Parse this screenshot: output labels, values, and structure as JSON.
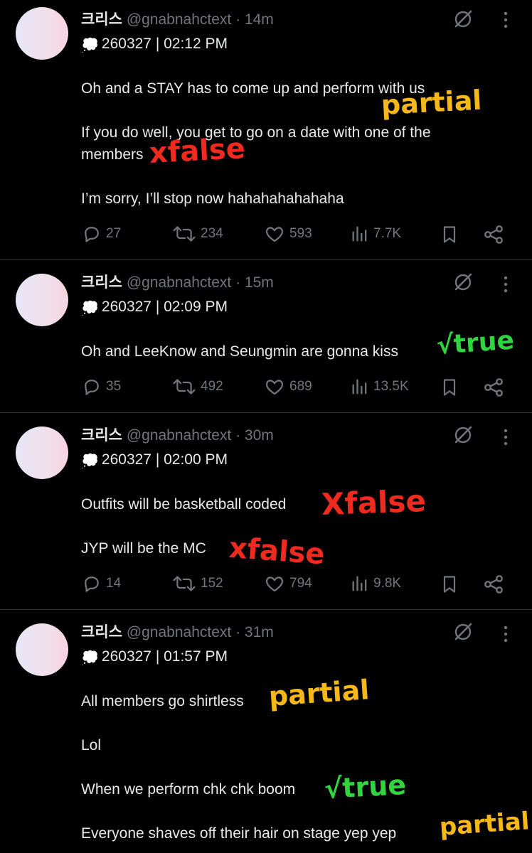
{
  "tweets": [
    {
      "name": "크리스",
      "handle": "@gnabnahctext",
      "time": "14m",
      "dot": "·",
      "sub": "260327 | 02:12 PM",
      "lines": [
        "Oh and a STAY has to come up and perform with us",
        "If you do well, you get to go on a date with one of the",
        "members",
        "I’m sorry, I’ll stop now hahahahahahaha"
      ],
      "replies": "27",
      "retweets": "234",
      "likes": "593",
      "views": "7.7K",
      "annotations": [
        "partial",
        "xfalse"
      ]
    },
    {
      "name": "크리스",
      "handle": "@gnabnahctext",
      "time": "15m",
      "dot": "·",
      "sub": "260327 | 02:09 PM",
      "lines": [
        "Oh and LeeKnow and Seungmin are gonna kiss"
      ],
      "replies": "35",
      "retweets": "492",
      "likes": "689",
      "views": "13.5K",
      "annotations": [
        "√true"
      ]
    },
    {
      "name": "크리스",
      "handle": "@gnabnahctext",
      "time": "30m",
      "dot": "·",
      "sub": "260327 | 02:00 PM",
      "lines": [
        "Outfits will be basketball coded",
        "JYP will be the MC"
      ],
      "replies": "14",
      "retweets": "152",
      "likes": "794",
      "views": "9.8K",
      "annotations": [
        "Xfalse",
        "xfalse"
      ]
    },
    {
      "name": "크리스",
      "handle": "@gnabnahctext",
      "time": "31m",
      "dot": "·",
      "sub": "260327 | 01:57 PM",
      "lines": [
        "All members go shirtless",
        "Lol",
        "When we perform chk chk boom",
        "Everyone shaves off their hair on stage yep yep"
      ],
      "annotations": [
        "partial",
        "√true",
        "partial"
      ]
    }
  ],
  "icons": {
    "avatar": "avatar",
    "bubble": "thought-bubble-emoji",
    "grok": "grok-slash-circle-icon",
    "more": "more-vertical-icon",
    "reply": "reply-icon",
    "retweet": "retweet-icon",
    "like": "heart-icon",
    "views": "views-bar-chart-icon",
    "bookmark": "bookmark-icon",
    "share": "share-icon"
  },
  "colors": {
    "background": "#000000",
    "text": "#e7e9ea",
    "muted": "#71767b",
    "divider": "#2f3336",
    "annotation_yellow": "#f5b818",
    "annotation_red": "#f02a1e",
    "annotation_green": "#2fd43e"
  }
}
